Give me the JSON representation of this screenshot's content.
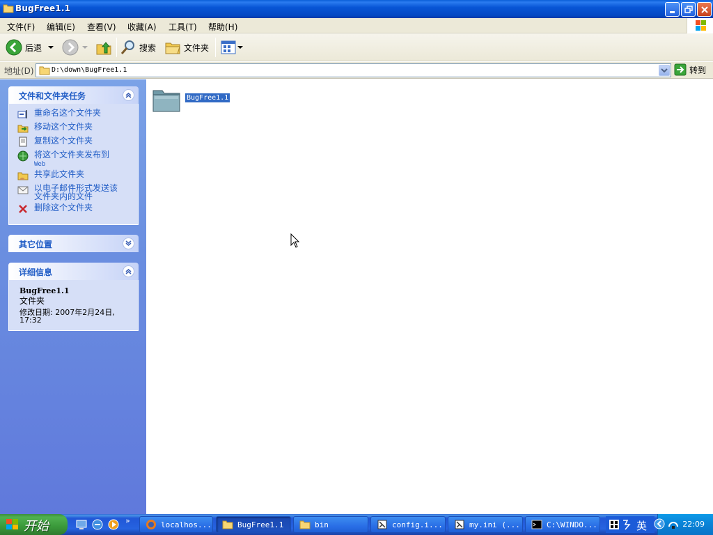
{
  "window": {
    "title": "BugFree1.1"
  },
  "menu": {
    "items": [
      "文件(F)",
      "编辑(E)",
      "查看(V)",
      "收藏(A)",
      "工具(T)",
      "帮助(H)"
    ]
  },
  "toolbar": {
    "back_label": "后退",
    "search_label": "搜索",
    "folders_label": "文件夹"
  },
  "address": {
    "label": "地址(D)",
    "value": "D:\\down\\BugFree1.1",
    "go_label": "转到"
  },
  "tasks_panel": {
    "title": "文件和文件夹任务",
    "items": [
      {
        "label": "重命名这个文件夹",
        "icon": "rename-icon"
      },
      {
        "label": "移动这个文件夹",
        "icon": "move-icon"
      },
      {
        "label": "复制这个文件夹",
        "icon": "copy-icon"
      },
      {
        "label": "将这个文件夹发布到",
        "label2": "Web",
        "icon": "publish-web-icon"
      },
      {
        "label": "共享此文件夹",
        "icon": "share-icon"
      },
      {
        "label": "以电子邮件形式发送该",
        "label2": "文件夹内的文件",
        "icon": "email-icon"
      },
      {
        "label": "删除这个文件夹",
        "icon": "delete-icon"
      }
    ]
  },
  "other_places": {
    "title": "其它位置"
  },
  "details": {
    "title": "详细信息",
    "name": "BugFree1.1",
    "type": "文件夹",
    "modified_line1": "修改日期: 2007年2月24日,",
    "modified_line2": "17:32"
  },
  "content": {
    "folder_name": "BugFree1.1"
  },
  "taskbar": {
    "start_label": "开始",
    "buttons": [
      {
        "label": "localhos...",
        "icon": "firefox-icon"
      },
      {
        "label": "BugFree1.1",
        "icon": "folder-icon",
        "active": true
      },
      {
        "label": "bin",
        "icon": "folder-icon"
      },
      {
        "label": "config.i...",
        "icon": "editor-icon"
      },
      {
        "label": "my.ini (...",
        "icon": "editor-icon"
      },
      {
        "label": "C:\\WINDO...",
        "icon": "cmd-icon"
      }
    ],
    "ime_label": "英",
    "clock": "22:09"
  },
  "colors": {
    "task_link": "#215dc6",
    "selection": "#316ac5",
    "title_bar": "#0856d6"
  }
}
